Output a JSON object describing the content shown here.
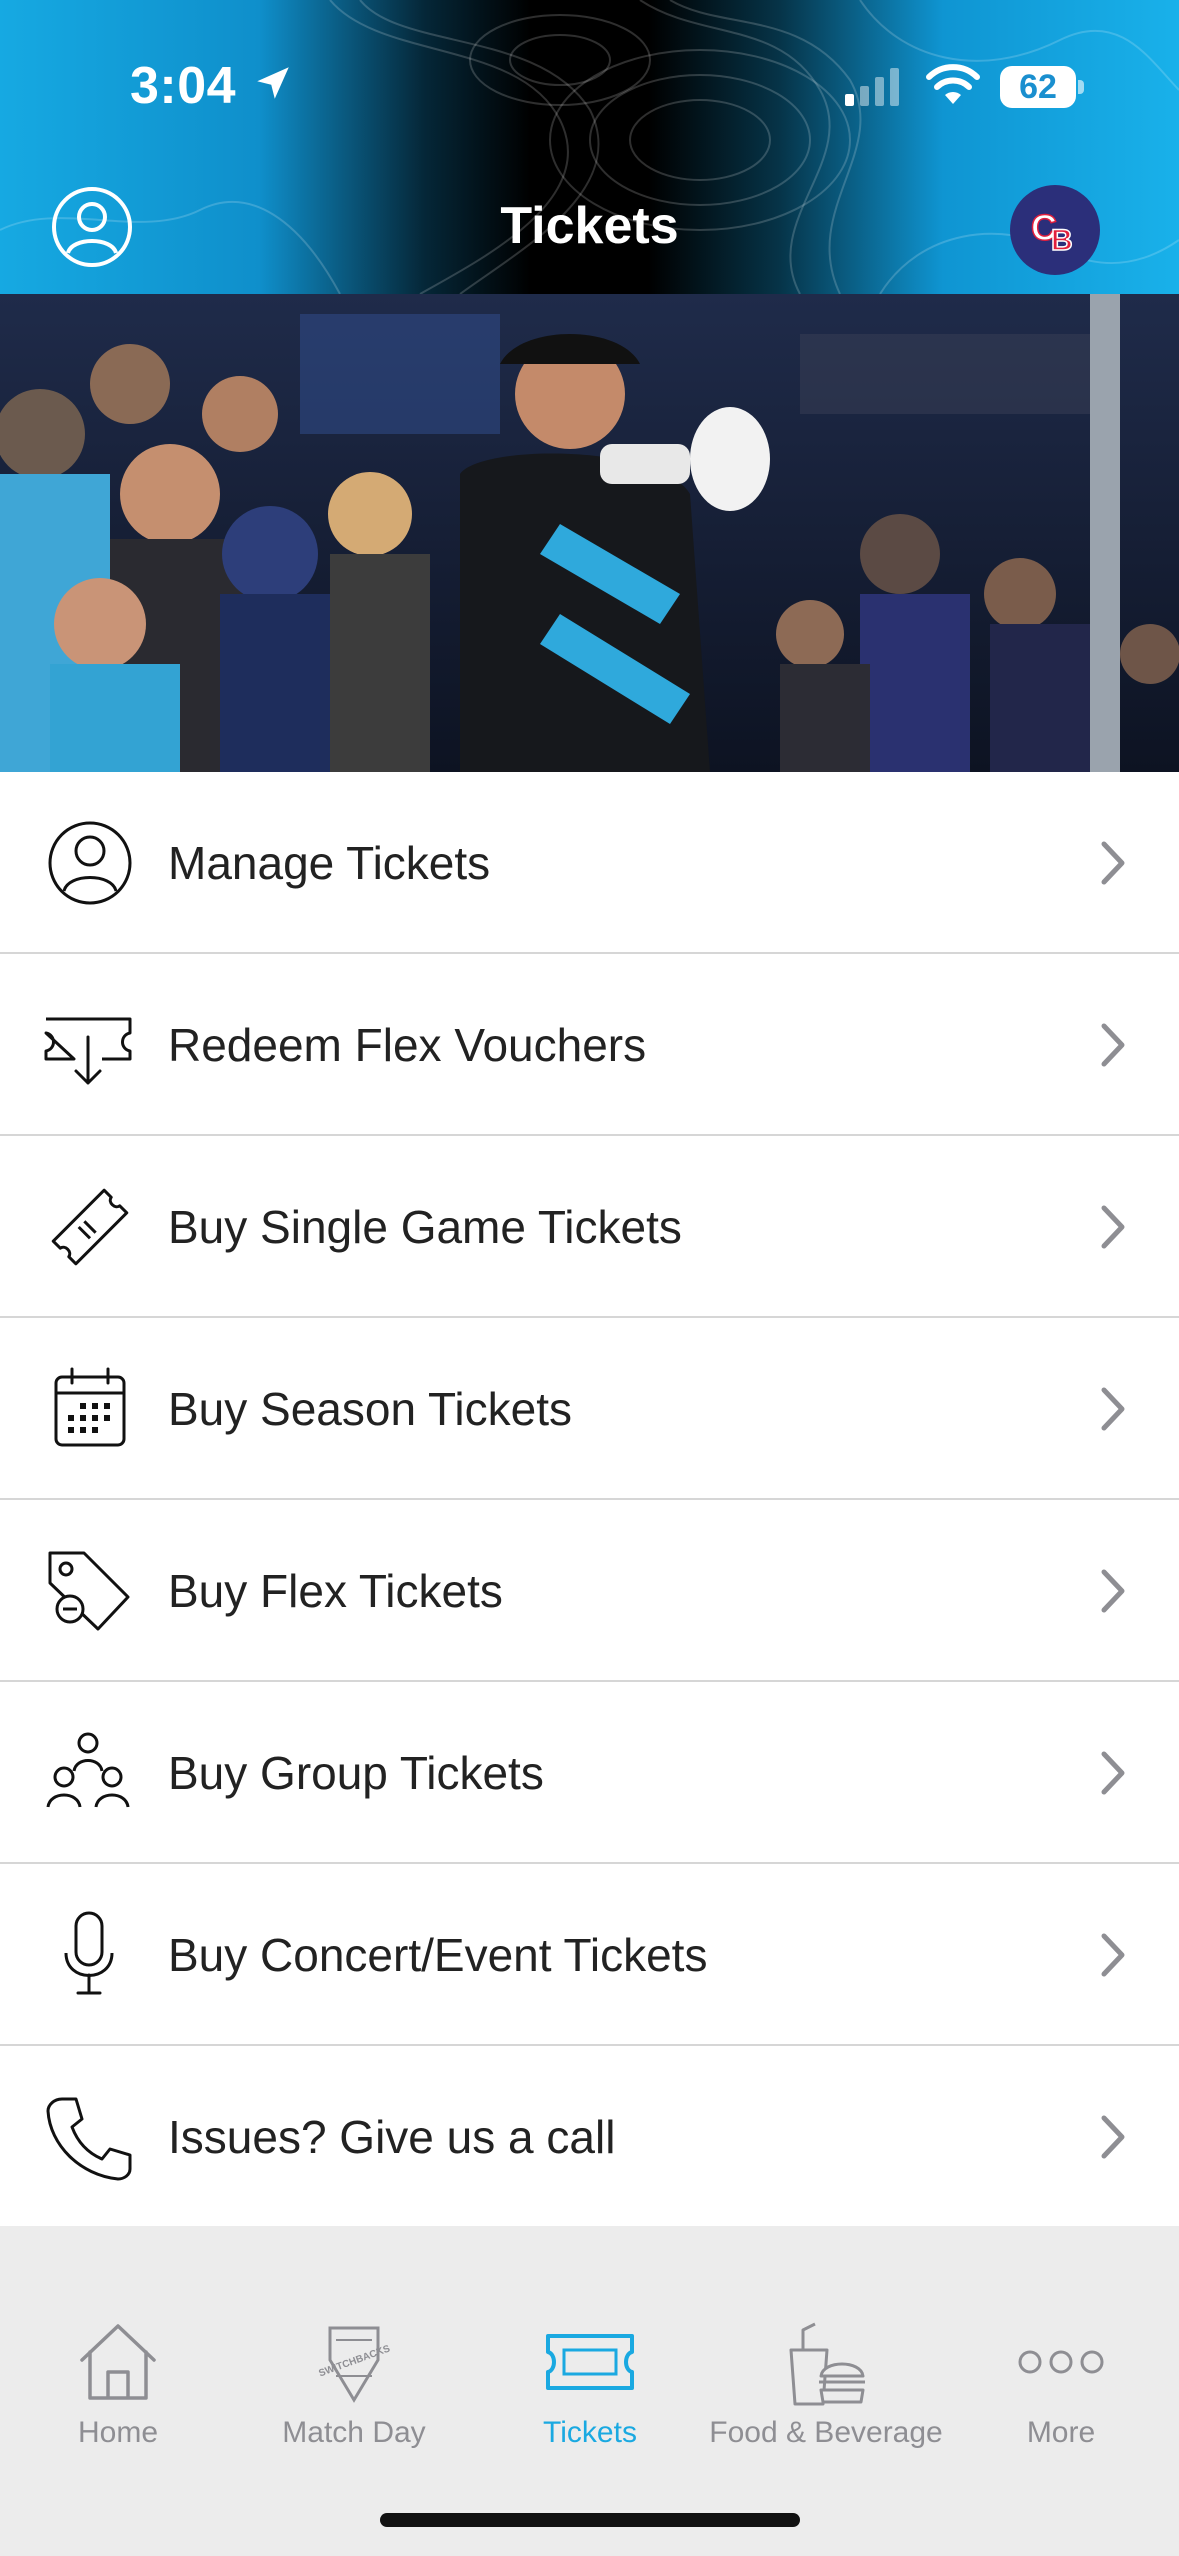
{
  "status_bar": {
    "time": "3:04",
    "battery": "62"
  },
  "header": {
    "title": "Tickets",
    "team_logo_text": "CB"
  },
  "menu": {
    "items": [
      {
        "label": "Manage Tickets",
        "icon": "user-circle-icon"
      },
      {
        "label": "Redeem Flex Vouchers",
        "icon": "voucher-icon"
      },
      {
        "label": "Buy Single Game Tickets",
        "icon": "ticket-icon"
      },
      {
        "label": "Buy Season Tickets",
        "icon": "calendar-icon"
      },
      {
        "label": "Buy Flex Tickets",
        "icon": "tag-icon"
      },
      {
        "label": "Buy Group Tickets",
        "icon": "group-icon"
      },
      {
        "label": "Buy Concert/Event Tickets",
        "icon": "microphone-icon"
      },
      {
        "label": "Issues? Give us a call",
        "icon": "phone-icon"
      }
    ]
  },
  "bottom_nav": {
    "items": [
      {
        "label": "Home",
        "icon": "home-icon"
      },
      {
        "label": "Match Day",
        "icon": "switchbacks-logo-icon",
        "logo_text": "SWITCHBACKS"
      },
      {
        "label": "Tickets",
        "icon": "ticket-icon",
        "active": true
      },
      {
        "label": "Food & Beverage",
        "icon": "food-beverage-icon"
      },
      {
        "label": "More",
        "icon": "more-icon"
      }
    ]
  },
  "colors": {
    "accent": "#1aa9e1",
    "inactive": "#8e8e93",
    "text": "#222222"
  }
}
